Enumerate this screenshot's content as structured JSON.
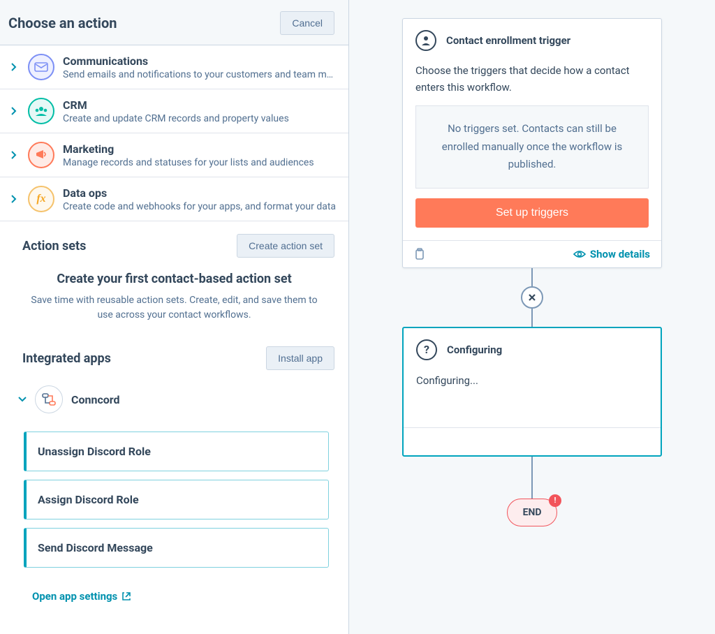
{
  "header": {
    "title": "Choose an action",
    "cancel_label": "Cancel"
  },
  "categories": [
    {
      "title": "Communications",
      "desc": "Send emails and notifications to your customers and team members",
      "color": "#7c8ff5",
      "bg": "#eef0ff",
      "icon": "chat-mail"
    },
    {
      "title": "CRM",
      "desc": "Create and update CRM records and property values",
      "color": "#00bda5",
      "bg": "#e5f8f6",
      "icon": "people"
    },
    {
      "title": "Marketing",
      "desc": "Manage records and statuses for your lists and audiences",
      "color": "#ff7a59",
      "bg": "#ffebe6",
      "icon": "megaphone"
    },
    {
      "title": "Data ops",
      "desc": "Create code and webhooks for your apps, and format your data",
      "color": "#f5c26b",
      "bg": "#fef8ee",
      "icon": "fx"
    }
  ],
  "action_sets": {
    "heading": "Action sets",
    "create_label": "Create action set",
    "empty_title": "Create your first contact-based action set",
    "empty_desc": "Save time with reusable action sets. Create, edit, and save them to use across your contact workflows."
  },
  "integrated_apps": {
    "heading": "Integrated apps",
    "install_label": "Install app",
    "apps": [
      {
        "name": "Conncord",
        "actions": [
          "Unassign Discord Role",
          "Assign Discord Role",
          "Send Discord Message"
        ]
      }
    ],
    "open_settings_label": "Open app settings"
  },
  "workflow": {
    "trigger": {
      "title": "Contact enrollment trigger",
      "desc": "Choose the triggers that decide how a contact enters this workflow.",
      "empty": "No triggers set. Contacts can still be enrolled manually once the workflow is published.",
      "setup_label": "Set up triggers",
      "show_details_label": "Show details"
    },
    "configuring": {
      "title": "Configuring",
      "body": "Configuring..."
    },
    "end_label": "END"
  }
}
